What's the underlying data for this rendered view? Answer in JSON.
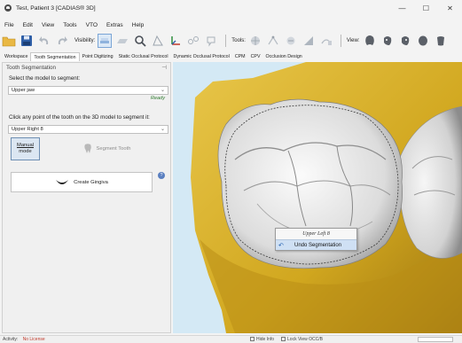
{
  "window": {
    "title": "Test, Patient 3 [CADIAS® 3D]",
    "controls": {
      "minimize": "—",
      "maximize": "☐",
      "close": "✕"
    }
  },
  "menu": [
    "File",
    "Edit",
    "View",
    "Tools",
    "VTO",
    "Extras",
    "Help"
  ],
  "toolbar": {
    "visibility_label": "Visibility:",
    "tools_label": "Tools:",
    "view_label": "View:"
  },
  "tabs": [
    "Workspace",
    "Tooth Segmentation",
    "Point Digitizing",
    "Static Occlusal Protocol",
    "Dynamic Occlusal Protocol",
    "CPM",
    "CPV",
    "Occlusion Design"
  ],
  "panel": {
    "title": "Tooth Segmentation",
    "pin": "⊣",
    "model_prompt": "Select the model to segment:",
    "model_value": "Upper jaw",
    "status": "Ready",
    "click_prompt": "Click any point of the tooth on the 3D model to segment it:",
    "tooth_value": "Upper Right 8",
    "manual_mode_line1": "Manual",
    "manual_mode_line2": "mode",
    "segment_tooth": "Segment Tooth",
    "create_gingiva": "Create Gingiva",
    "help": "?"
  },
  "context_menu": {
    "title": "Upper Left 8",
    "item": "Undo Segmentation"
  },
  "statusbar": {
    "left": "Activity:",
    "left_error": "No License",
    "check1": "Hide Info",
    "check2": "Lock View OCC/B",
    "progress": 0
  },
  "colors": {
    "viewport_bg": "#d4e9f5",
    "gingiva": "#d8b12a",
    "tooth": "#eeeeee",
    "highlight": "#cfe0f4"
  }
}
